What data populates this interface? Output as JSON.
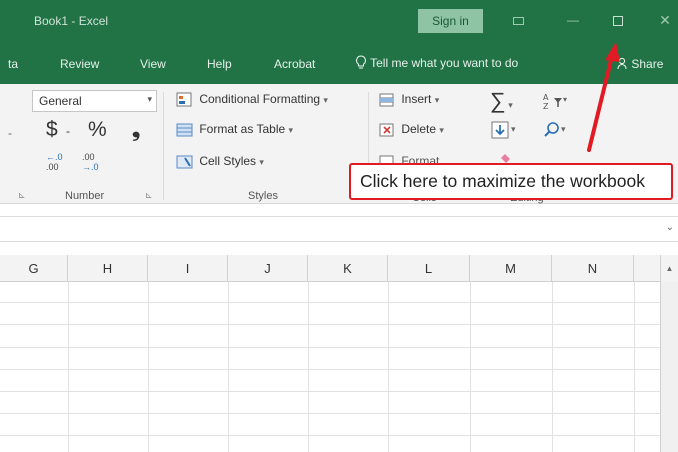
{
  "window": {
    "title": "Book1  -  Excel",
    "signin_label": "Sign in",
    "minimize": "—",
    "close": "✕"
  },
  "tabs": [
    {
      "label": "ta"
    },
    {
      "label": "Review"
    },
    {
      "label": "View"
    },
    {
      "label": "Help"
    },
    {
      "label": "Acrobat"
    }
  ],
  "tellme": "Tell me what you want to do",
  "share": "Share",
  "ribbon": {
    "number": {
      "format_value": "General",
      "currency": "$",
      "currency_dd": "-",
      "percent": "%",
      "comma": "❟",
      "inc_decimal_top": "←.0",
      "inc_decimal_bottom": ".00",
      "dec_decimal_top": ".00",
      "dec_decimal_bottom": "→.0",
      "group_label": "Number"
    },
    "styles": {
      "conditional": "Conditional Formatting",
      "format_table": "Format as Table",
      "cell_styles": "Cell Styles",
      "group_label": "Styles"
    },
    "cells": {
      "insert": "Insert",
      "delete": "Delete",
      "format_partial": "Format",
      "group_label": "Cells"
    },
    "editing": {
      "group_label": "Editing"
    }
  },
  "columns": [
    "G",
    "H",
    "I",
    "J",
    "K",
    "L",
    "M",
    "N"
  ],
  "callout": "Click here to maximize the workbook",
  "colors": {
    "excel_green": "#217346",
    "annotation_red": "#e01b24"
  }
}
